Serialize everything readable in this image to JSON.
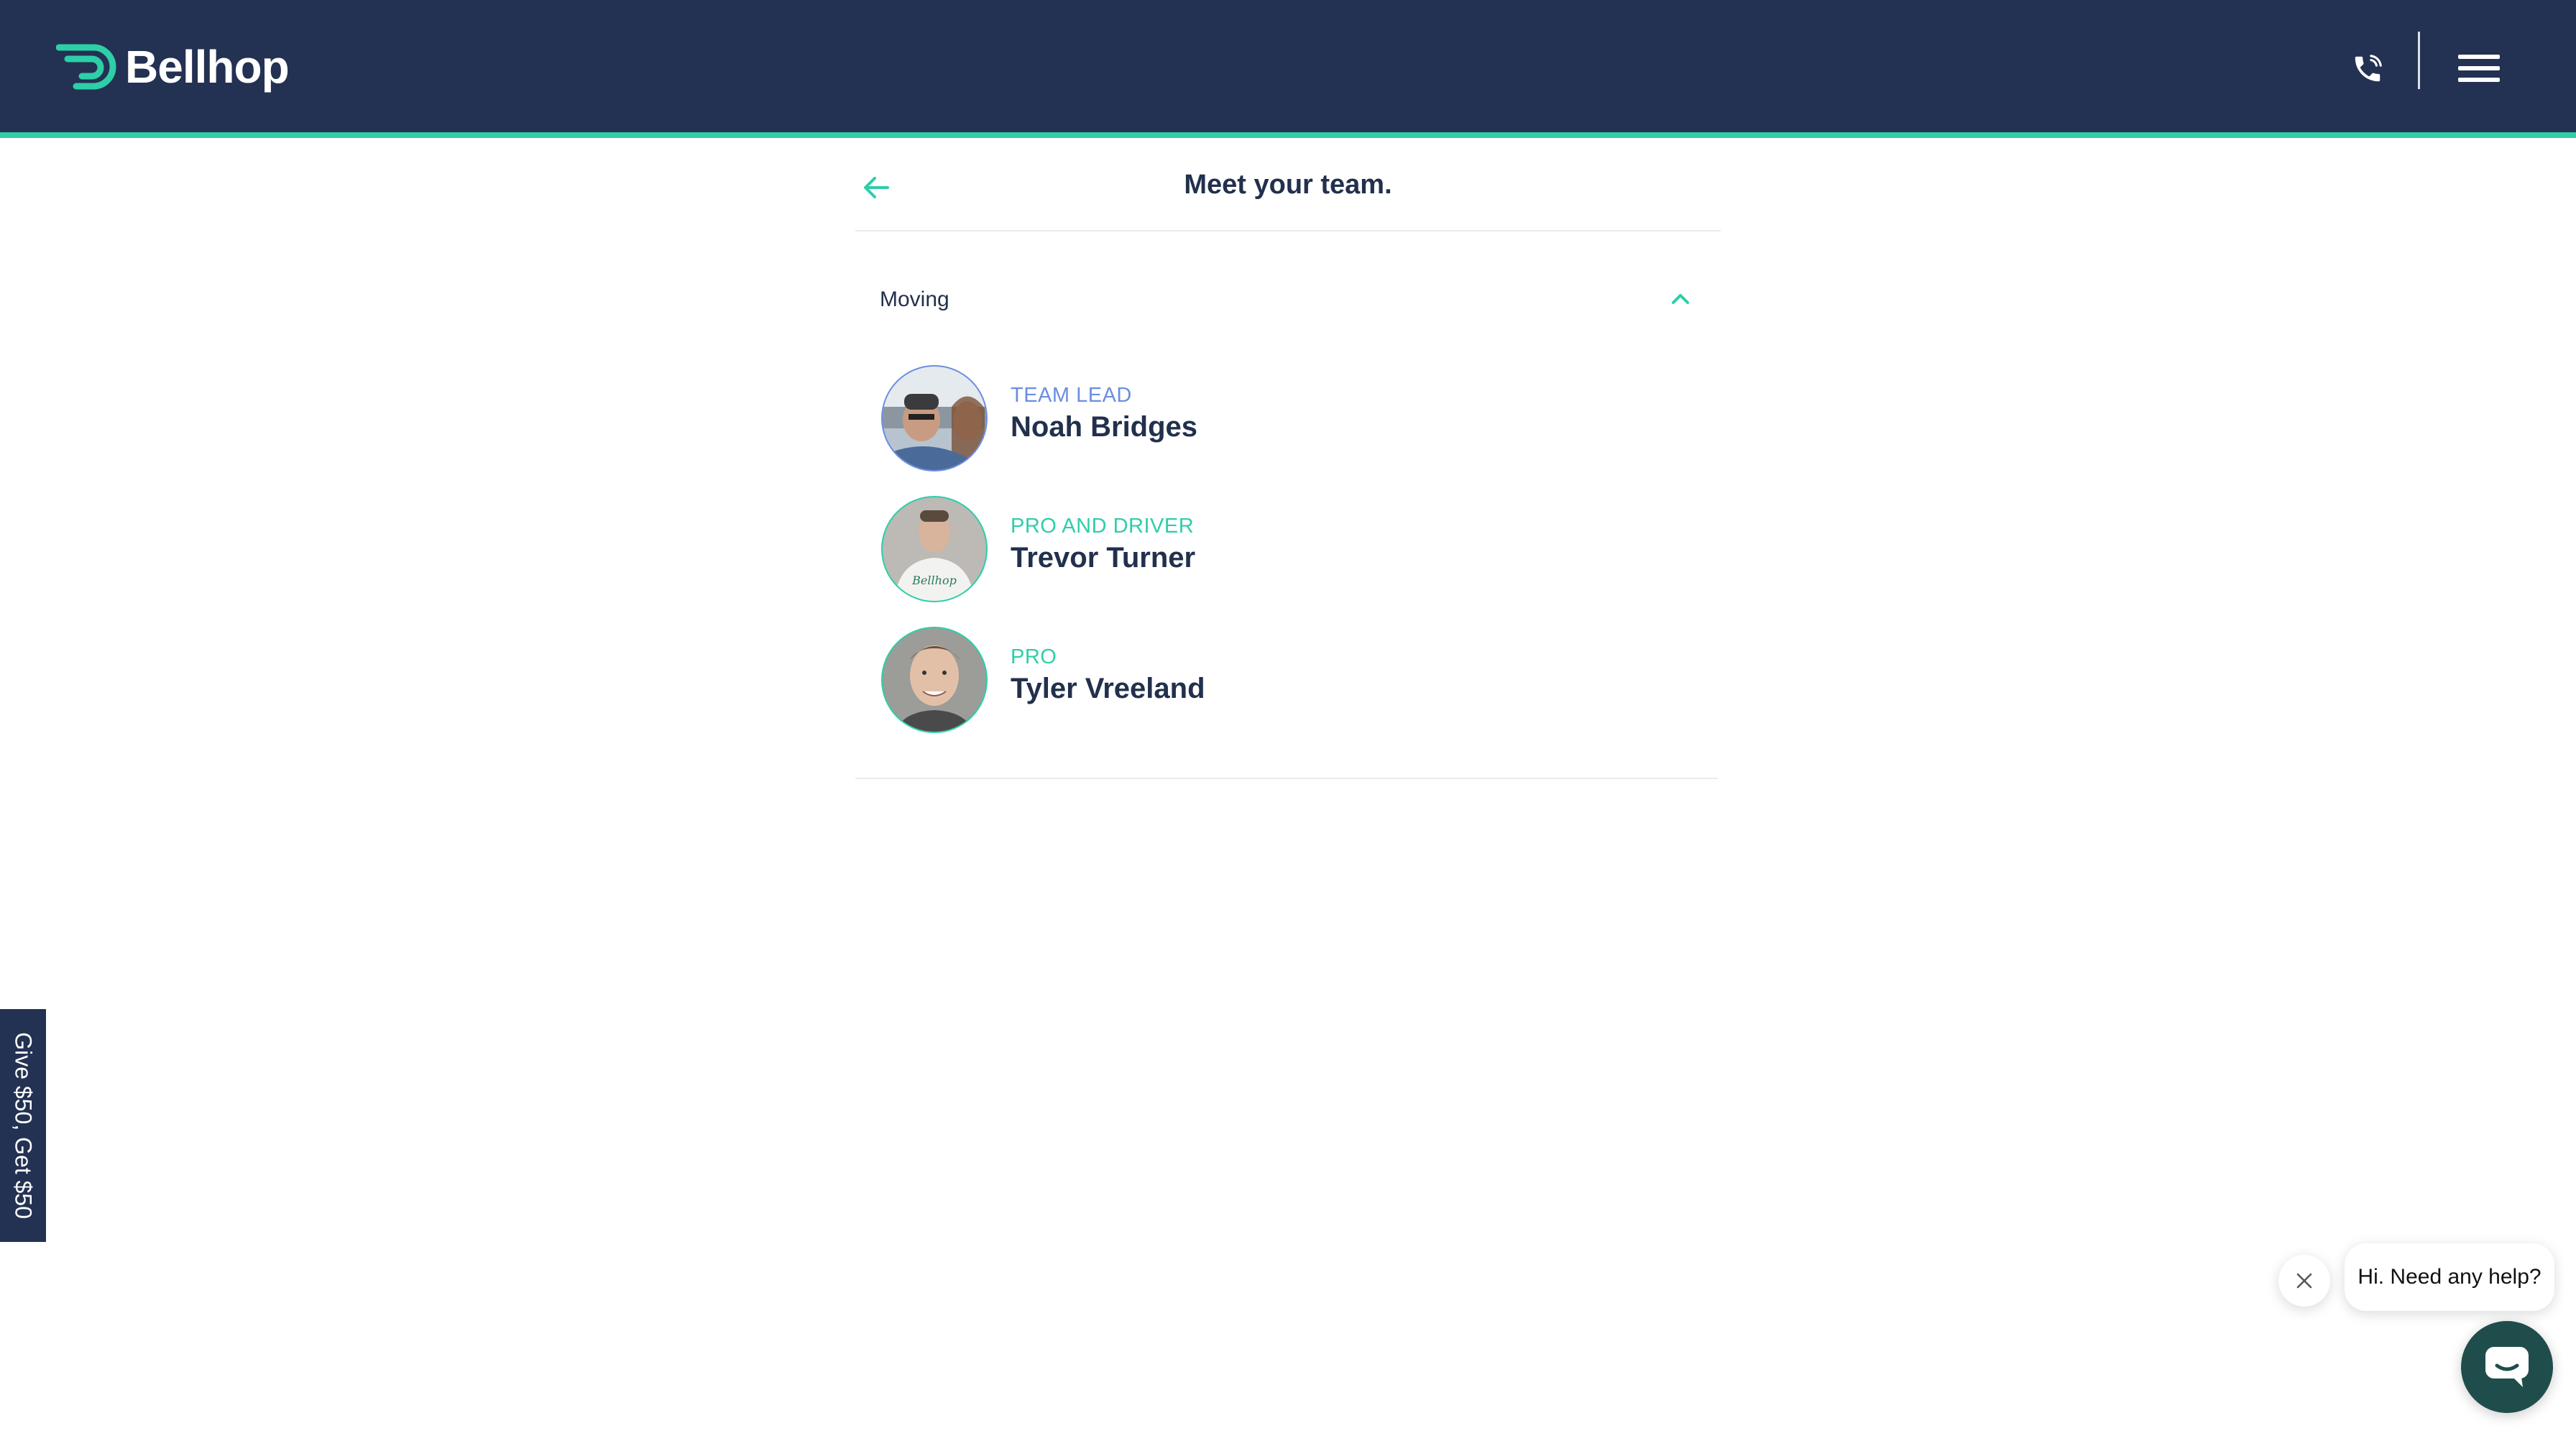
{
  "header": {
    "logo_text": "Bellhop",
    "phone_icon": "phone-icon",
    "menu_icon": "hamburger-menu-icon"
  },
  "page": {
    "title": "Meet your team.",
    "back_icon": "arrow-left-icon"
  },
  "section": {
    "label": "Moving",
    "toggle_icon": "chevron-up-icon",
    "expanded": true
  },
  "team": [
    {
      "role": "TEAM LEAD",
      "name": "Noah Bridges",
      "role_color": "#6a8ee0"
    },
    {
      "role": "PRO AND DRIVER",
      "name": "Trevor Turner",
      "role_color": "#2dcea8"
    },
    {
      "role": "PRO",
      "name": "Tyler Vreeland",
      "role_color": "#2dcea8"
    }
  ],
  "referral": {
    "label": "Give $50, Get $50"
  },
  "chat": {
    "greeting": "Hi. Need any help?",
    "close_icon": "close-icon",
    "launcher_icon": "chat-icon"
  },
  "colors": {
    "navy": "#233152",
    "accent": "#2dcea8",
    "lead_blue": "#6a8ee0",
    "chat_green": "#1f4d4b"
  }
}
